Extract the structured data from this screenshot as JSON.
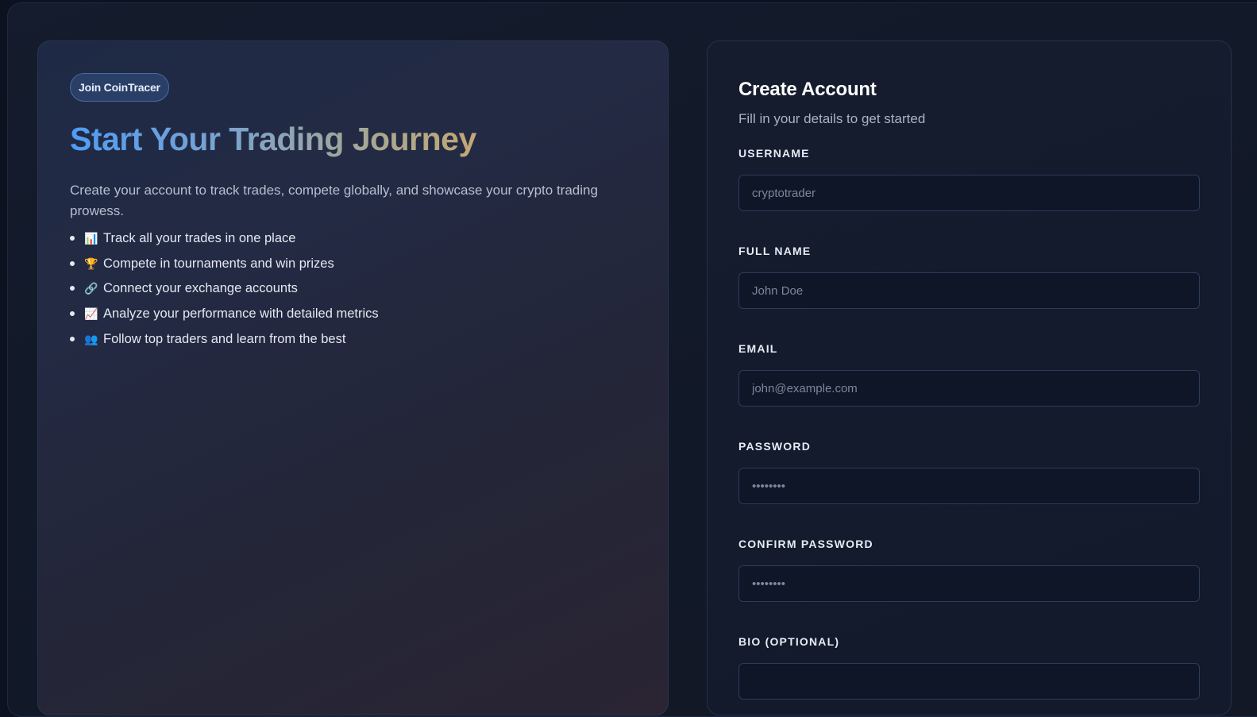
{
  "hero": {
    "badge": "Join CoinTracer",
    "title": "Start Your Trading Journey",
    "description": "Create your account to track trades, compete globally, and showcase your crypto trading prowess.",
    "features": [
      {
        "icon": "bar-chart-icon",
        "emoji": "📊",
        "text": "Track all your trades in one place"
      },
      {
        "icon": "trophy-icon",
        "emoji": "🏆",
        "text": "Compete in tournaments and win prizes"
      },
      {
        "icon": "link-icon",
        "emoji": "🔗",
        "text": "Connect your exchange accounts"
      },
      {
        "icon": "trending-up-icon",
        "emoji": "📈",
        "text": "Analyze your performance with detailed metrics"
      },
      {
        "icon": "users-icon",
        "emoji": "👥",
        "text": "Follow top traders and learn from the best"
      }
    ],
    "title_gradient": [
      "#4f9cf5",
      "#7ea3cc",
      "#a8a890",
      "#c4a775"
    ]
  },
  "form": {
    "title": "Create Account",
    "subtitle": "Fill in your details to get started",
    "fields": [
      {
        "label": "USERNAME",
        "placeholder": "cryptotrader",
        "value": ""
      },
      {
        "label": "FULL NAME",
        "placeholder": "John Doe",
        "value": ""
      },
      {
        "label": "EMAIL",
        "placeholder": "john@example.com",
        "value": ""
      },
      {
        "label": "PASSWORD",
        "placeholder": "••••••••",
        "value": ""
      },
      {
        "label": "CONFIRM PASSWORD",
        "placeholder": "••••••••",
        "value": ""
      },
      {
        "label": "BIO (OPTIONAL)",
        "placeholder": "",
        "value": ""
      }
    ]
  },
  "colors": {
    "background": "#0c1220",
    "badge_bg": "#2a3f66",
    "input_border": "#2a3c5c"
  }
}
